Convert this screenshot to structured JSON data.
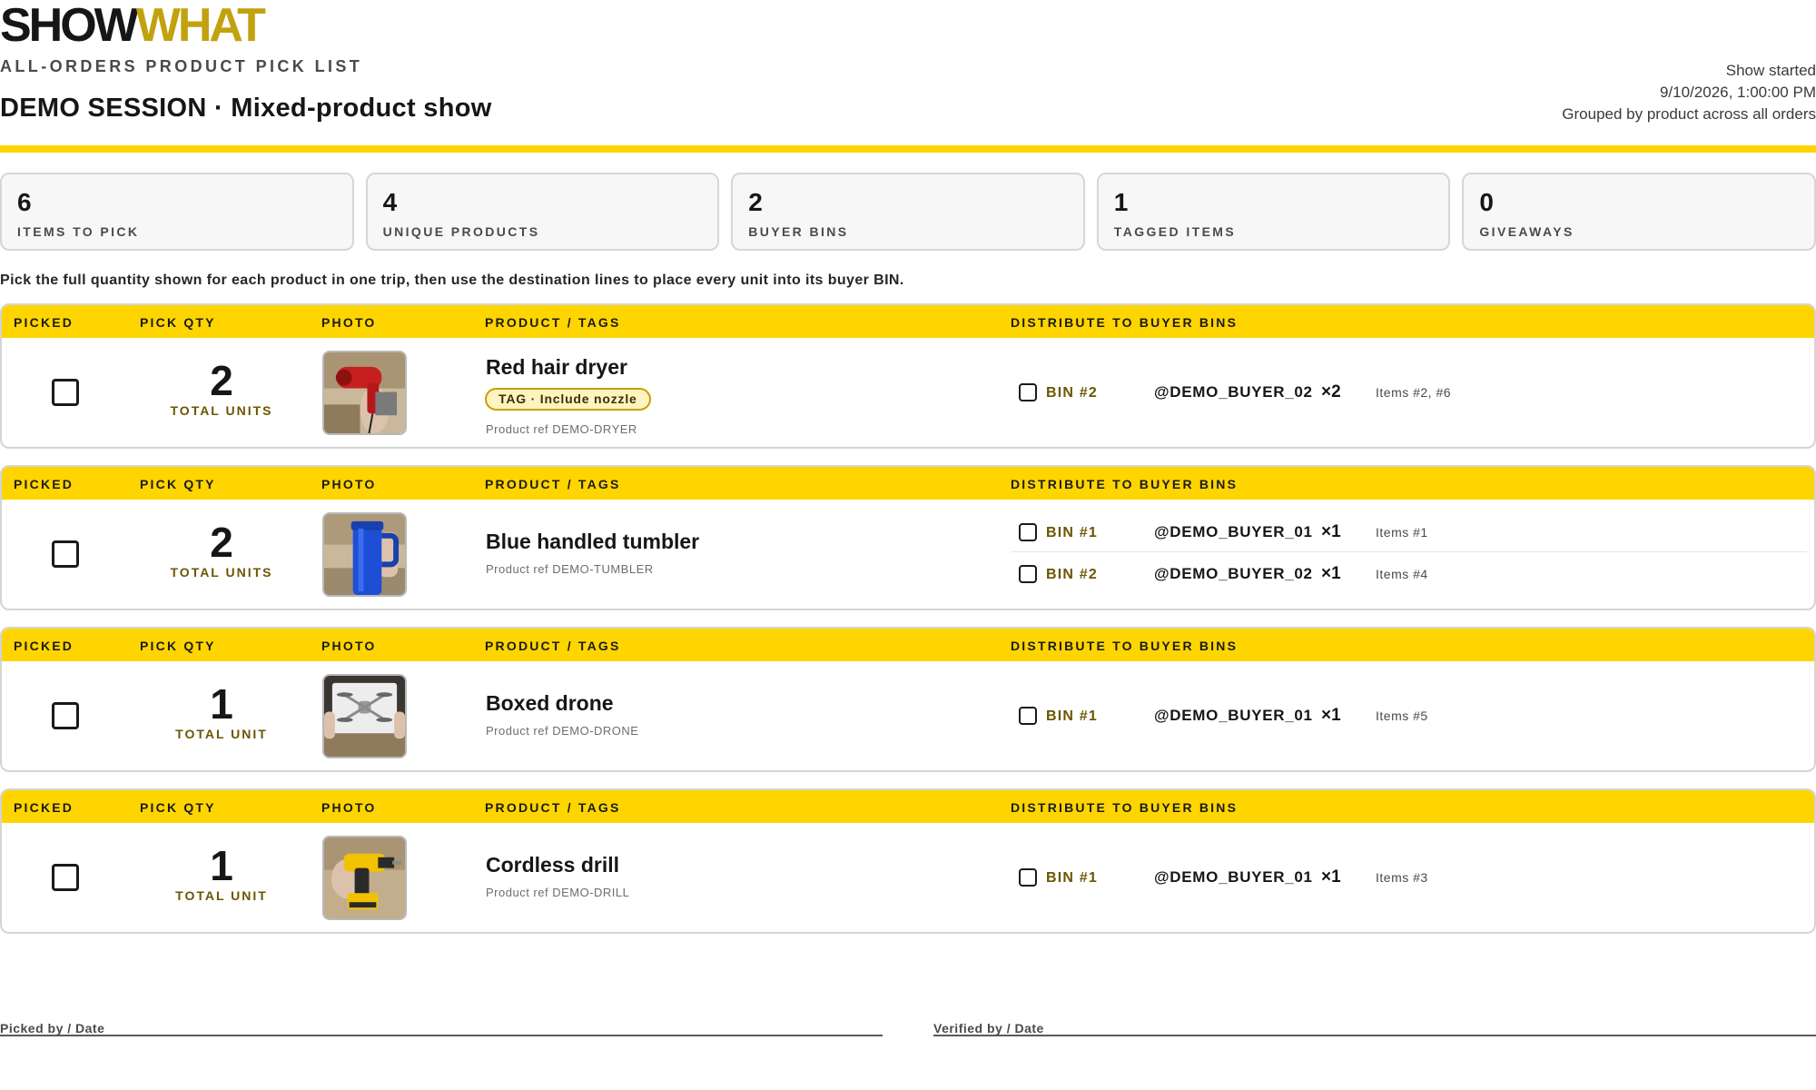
{
  "brand": {
    "part1": "SHOW",
    "part2": "WHAT"
  },
  "header": {
    "subtitle": "ALL-ORDERS PRODUCT PICK LIST",
    "session": "DEMO SESSION · Mixed-product show",
    "meta": {
      "started_label": "Show started",
      "started_value": "9/10/2026, 1:00:00 PM",
      "grouping": "Grouped by product across all orders"
    }
  },
  "stats": [
    {
      "value": "6",
      "label": "ITEMS TO PICK"
    },
    {
      "value": "4",
      "label": "UNIQUE PRODUCTS"
    },
    {
      "value": "2",
      "label": "BUYER BINS"
    },
    {
      "value": "1",
      "label": "TAGGED ITEMS"
    },
    {
      "value": "0",
      "label": "GIVEAWAYS"
    }
  ],
  "instructions": "Pick the full quantity shown for each product in one trip, then use the destination lines to place every unit into its buyer BIN.",
  "columns": {
    "picked": "PICKED",
    "pick_qty": "PICK QTY",
    "photo": "PHOTO",
    "product": "PRODUCT / TAGS",
    "distribute": "DISTRIBUTE TO BUYER BINS"
  },
  "products": [
    {
      "name": "Red hair dryer",
      "qty": "2",
      "unit_label": "TOTAL UNITS",
      "tag": "TAG · Include nozzle",
      "ref": "Product ref DEMO-DRYER",
      "picked": false,
      "destinations": [
        {
          "bin": "BIN #2",
          "buyer": "@DEMO_BUYER_02",
          "count": "×2",
          "items": "Items #2, #6"
        }
      ]
    },
    {
      "name": "Blue handled tumbler",
      "qty": "2",
      "unit_label": "TOTAL UNITS",
      "tag": "",
      "ref": "Product ref DEMO-TUMBLER",
      "picked": false,
      "destinations": [
        {
          "bin": "BIN #1",
          "buyer": "@DEMO_BUYER_01",
          "count": "×1",
          "items": "Items #1"
        },
        {
          "bin": "BIN #2",
          "buyer": "@DEMO_BUYER_02",
          "count": "×1",
          "items": "Items #4"
        }
      ]
    },
    {
      "name": "Boxed drone",
      "qty": "1",
      "unit_label": "TOTAL UNIT",
      "tag": "",
      "ref": "Product ref DEMO-DRONE",
      "picked": false,
      "destinations": [
        {
          "bin": "BIN #1",
          "buyer": "@DEMO_BUYER_01",
          "count": "×1",
          "items": "Items #5"
        }
      ]
    },
    {
      "name": "Cordless drill",
      "qty": "1",
      "unit_label": "TOTAL UNIT",
      "tag": "",
      "ref": "Product ref DEMO-DRILL",
      "picked": false,
      "destinations": [
        {
          "bin": "BIN #1",
          "buyer": "@DEMO_BUYER_01",
          "count": "×1",
          "items": "Items #3"
        }
      ]
    }
  ],
  "signatures": {
    "picked_by": "Picked by / Date",
    "verified_by": "Verified by / Date"
  }
}
